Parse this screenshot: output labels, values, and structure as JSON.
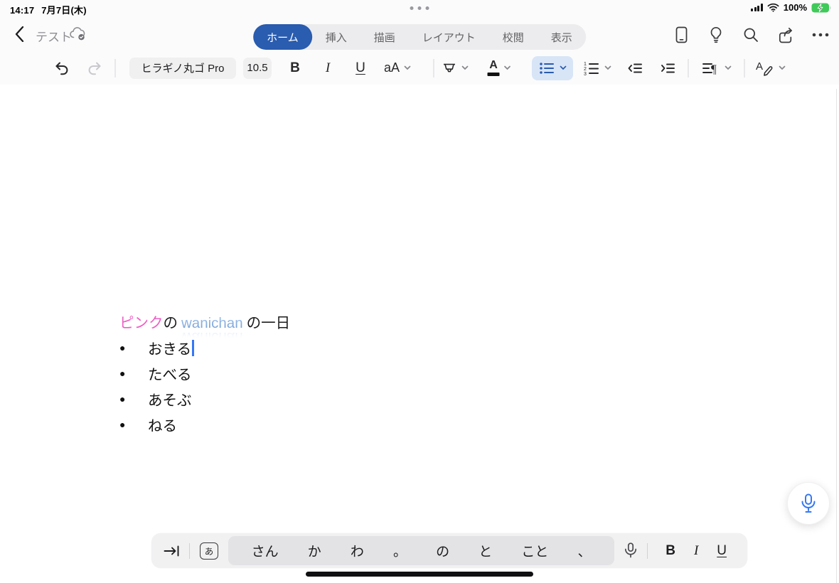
{
  "status_bar": {
    "time": "14:17",
    "date": "7月7日(木)",
    "battery_percent": "100%"
  },
  "nav": {
    "document_title": "テスト",
    "tabs": [
      {
        "label": "ホーム",
        "selected": true
      },
      {
        "label": "挿入",
        "selected": false
      },
      {
        "label": "描画",
        "selected": false
      },
      {
        "label": "レイアウト",
        "selected": false
      },
      {
        "label": "校閲",
        "selected": false
      },
      {
        "label": "表示",
        "selected": false
      }
    ],
    "right_icons": [
      "mobile-view-icon",
      "lightbulb-icon",
      "search-icon",
      "share-icon",
      "more-ellipsis-icon"
    ]
  },
  "toolbar": {
    "font_name": "ヒラギノ丸ゴ Pro",
    "font_size": "10.5",
    "bold_label": "B",
    "italic_label": "I",
    "underline_label": "U",
    "size_case_label": "aA",
    "icons": [
      "undo-icon",
      "redo-icon",
      "highlighter-icon",
      "font-color-icon",
      "bullet-list-icon",
      "numbered-list-icon",
      "outdent-icon",
      "indent-icon",
      "paragraph-format-icon",
      "style-pen-icon"
    ],
    "active_tool": "bullet-list"
  },
  "document": {
    "title": {
      "pink_text": "ピンク",
      "connector": "の",
      "link_text": "wanichan",
      "suffix": "の一日"
    },
    "bullets": [
      "おきる",
      "たべる",
      "あそぶ",
      "ねる"
    ]
  },
  "keyboard_bar": {
    "kana_mode_label": "あ",
    "suggestions": [
      "さん",
      "か",
      "わ",
      "。",
      "の",
      "と",
      "こと",
      "、"
    ],
    "bold_label": "B",
    "italic_label": "I",
    "underline_label": "U",
    "icons": [
      "tab-key-icon",
      "kana-mode-icon",
      "dictation-mic-icon"
    ]
  },
  "colors": {
    "accent_blue": "#2a5caf",
    "selected_tool_bg": "#d8e5f7",
    "pink_text": "#ee5fc4",
    "link_blue": "#7fa8dc",
    "battery_green": "#3fca5a",
    "caret_blue": "#3478f6"
  }
}
